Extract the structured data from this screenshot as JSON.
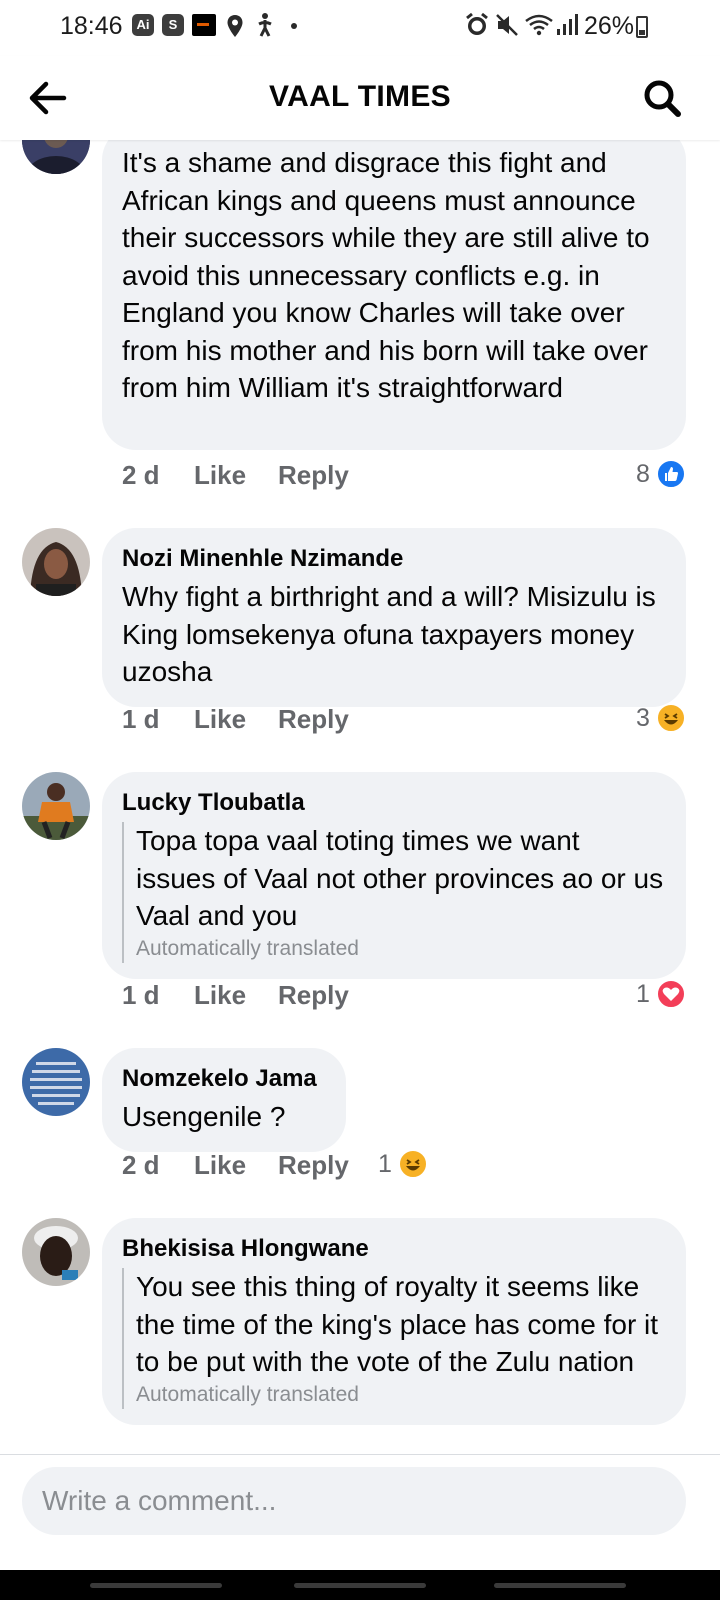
{
  "status_bar": {
    "time": "18:46",
    "icons": [
      "ai-icon",
      "s-icon",
      "app-icon",
      "location-icon",
      "accessibility-icon",
      "dot-icon",
      "alarm-icon",
      "mute-icon",
      "wifi-icon",
      "signal-icon",
      "battery-icon"
    ],
    "ai_label": "Ai",
    "s_label": "S",
    "battery": "26%"
  },
  "header": {
    "title": "VAAL TIMES",
    "back_icon": "arrow-left-icon",
    "search_icon": "search-icon"
  },
  "comments": [
    {
      "author": "",
      "text": "It's a shame and disgrace this fight and African kings and queens must announce their successors while they are still alive to avoid this unnecessary conflicts e.g. in England you know Charles will take over from his mother and his born will take over from him William it's straightforward",
      "time": "2 d",
      "like": "Like",
      "reply": "Reply",
      "reaction_count": "8",
      "reaction": "like"
    },
    {
      "author": "Nozi Minenhle Nzimande",
      "text": "Why fight a birthright and a will? Misizulu is King lomsekenya ofuna taxpayers money uzosha",
      "time": "1 d",
      "like": "Like",
      "reply": "Reply",
      "reaction_count": "3",
      "reaction": "haha"
    },
    {
      "author": "Lucky Tloubatla",
      "text": "Topa topa vaal toting times we want issues of Vaal not other provinces ao or us Vaal and you",
      "translated_note": "Automatically translated",
      "time": "1 d",
      "like": "Like",
      "reply": "Reply",
      "reaction_count": "1",
      "reaction": "love"
    },
    {
      "author": "Nomzekelo Jama",
      "text": "Usengenile ?",
      "time": "2 d",
      "like": "Like",
      "reply": "Reply",
      "reaction_count": "1",
      "reaction": "haha"
    },
    {
      "author": "Bhekisisa Hlongwane",
      "text": "You see this thing of royalty it seems like the time of the king's place has come for it to be put with the vote of the Zulu nation",
      "translated_note": "Automatically translated"
    }
  ],
  "composer": {
    "placeholder": "Write a comment..."
  },
  "colors": {
    "bubble": "#f0f2f5",
    "meta": "#65676b",
    "like_blue": "#1877f2",
    "haha_yellow": "#f7b125",
    "love_red": "#f33e58"
  }
}
